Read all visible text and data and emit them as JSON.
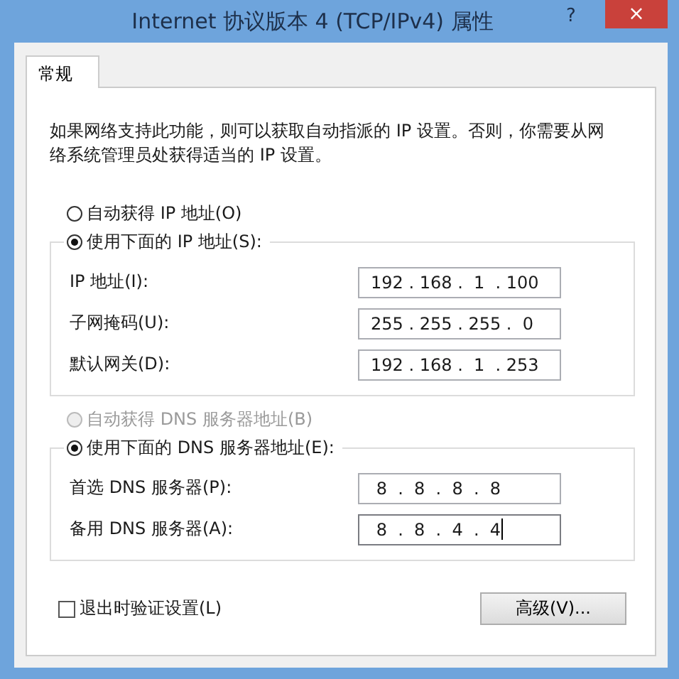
{
  "window": {
    "title": "Internet 协议版本 4 (TCP/IPv4) 属性",
    "help_button": "?",
    "close_button": "×"
  },
  "tabs": [
    {
      "label": "常规",
      "selected": true
    }
  ],
  "description": "如果网络支持此功能，则可以获取自动指派的 IP 设置。否则，你需要从网络系统管理员处获得适当的 IP 设置。",
  "sections": [
    {
      "auto_option": {
        "label": "自动获得 IP 地址(O)",
        "selected": false,
        "disabled": false
      },
      "manual_option": {
        "label": "使用下面的 IP 地址(S):",
        "selected": true,
        "disabled": false
      },
      "fields": [
        {
          "label": "IP 地址(I):",
          "value": "192 . 168 .  1  . 100",
          "focused": false
        },
        {
          "label": "子网掩码(U):",
          "value": "255 . 255 . 255 .  0",
          "focused": false
        },
        {
          "label": "默认网关(D):",
          "value": "192 . 168 .  1  . 253",
          "focused": false
        }
      ]
    },
    {
      "auto_option": {
        "label": "自动获得 DNS 服务器地址(B)",
        "selected": false,
        "disabled": true
      },
      "manual_option": {
        "label": "使用下面的 DNS 服务器地址(E):",
        "selected": true,
        "disabled": false
      },
      "fields": [
        {
          "label": "首选 DNS 服务器(P):",
          "value": " 8  .  8  .  8  .  8",
          "focused": false
        },
        {
          "label": "备用 DNS 服务器(A):",
          "value": " 8  .  8  .  4  .  4",
          "focused": true
        }
      ]
    }
  ],
  "validate_checkbox": {
    "label": "退出时验证设置(L)",
    "checked": false
  },
  "advanced_button": "高级(V)..."
}
